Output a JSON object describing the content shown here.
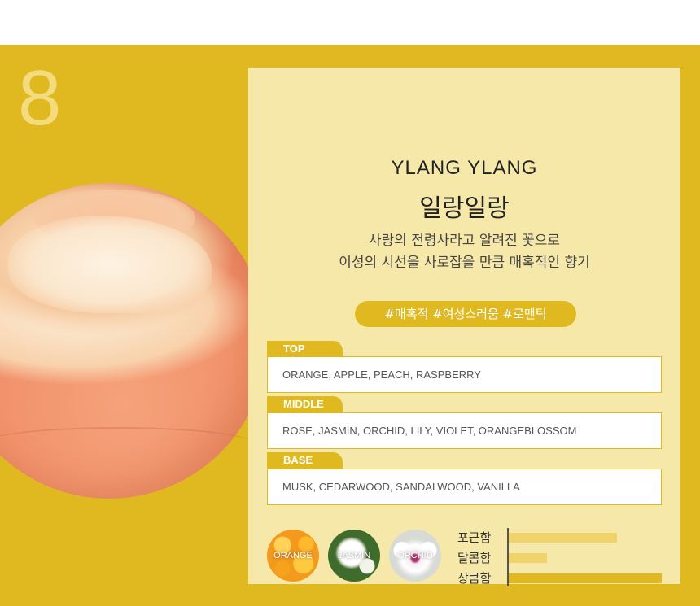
{
  "product": {
    "number": "8",
    "title_en": "YLANG YLANG",
    "title_ko": "일랑일랑",
    "description_lines": [
      "사랑의 전령사라고 알려진 꽃으로",
      "이성의 시선을 사로잡을 만큼 매혹적인 향기"
    ],
    "tags": "#매혹적 #여성스러움 #로맨틱"
  },
  "notes": [
    {
      "label": "TOP",
      "value": "ORANGE, APPLE, PEACH, RASPBERRY"
    },
    {
      "label": "MIDDLE",
      "value": "ROSE, JASMIN, ORCHID, LILY, VIOLET, ORANGEBLOSSOM"
    },
    {
      "label": "BASE",
      "value": "MUSK, CEDARWOOD, SANDALWOOD, VANILLA"
    }
  ],
  "ingredients": [
    {
      "label": "ORANGE",
      "icon": "orange-slice-photo"
    },
    {
      "label": "JASMIN",
      "icon": "jasmine-flower-photo"
    },
    {
      "label": "ORCHID",
      "icon": "orchid-flower-photo"
    }
  ],
  "scales": [
    {
      "label": "포근함",
      "level": 0.71,
      "color": "#f0d36a"
    },
    {
      "label": "달콤함",
      "level": 0.25,
      "color": "#f0d36a"
    },
    {
      "label": "상큼함",
      "level": 1.0,
      "color": "#e0b81f"
    }
  ],
  "colors": {
    "accent": "#e0b81f",
    "panel": "#f6e8a9",
    "number": "#f4dc7c"
  }
}
